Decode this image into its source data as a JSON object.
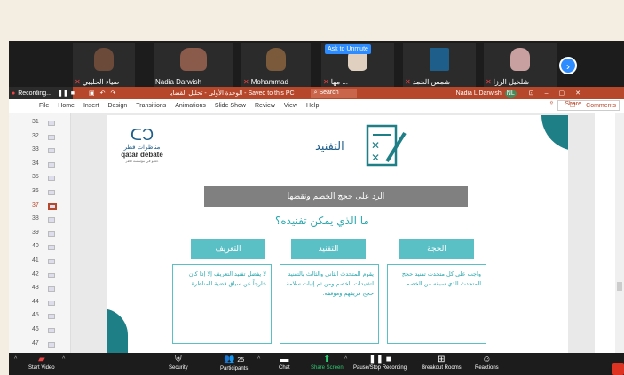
{
  "participants": [
    {
      "name": "ضياء الحليبي",
      "color": "#6b4a3a"
    },
    {
      "name": "Nadia Darwish",
      "color": "#8a5a4a"
    },
    {
      "name": "Mohammad",
      "color": "#7a5a3a"
    },
    {
      "name": "مها ...",
      "color": "#e0d0c0",
      "ask_to_unmute": "Ask to Unmute"
    },
    {
      "name": "شمس الحمد",
      "color": "#1e5e8a"
    },
    {
      "name": "شلخيل الرزا",
      "color": "#c8a0a0"
    }
  ],
  "recording": {
    "label": "Recording..."
  },
  "ppt": {
    "window_title": "الوحدة الأولى - تحليل القضايا - Saved to this PC",
    "search_placeholder": "Search",
    "user_name": "Nadia L Darwish",
    "user_initials": "NL",
    "menu": [
      "File",
      "Home",
      "Insert",
      "Design",
      "Transitions",
      "Animations",
      "Slide Show",
      "Review",
      "View",
      "Help"
    ],
    "share_label": "Share",
    "comments_label": "Comments",
    "slide_numbers": [
      "31",
      "32",
      "33",
      "34",
      "35",
      "36",
      "37",
      "38",
      "39",
      "40",
      "41",
      "42",
      "43",
      "44",
      "45",
      "46",
      "47"
    ],
    "selected_slide": "37"
  },
  "slide": {
    "logo_ar": "مناظرات قطر",
    "logo_en": "qatar debate",
    "logo_sub": "عضو في مؤسسة قطر",
    "title": "التفنيد",
    "subtitle": "الرد على حجج الخصم ونقضها",
    "question": "ما الذي يمكن تفنيده؟",
    "boxes": [
      {
        "label": "الحجة",
        "text": "واجب على كل متحدث تفنيد حجج المتحدث الذي سبقه من الخصم."
      },
      {
        "label": "التفنيد",
        "text": "يقوم المتحدث الثاني والثالث بالتفنيد لتفنيدات الخصم ومن ثم إثبات سلامة حجج فريقهم وموقفه."
      },
      {
        "label": "التعريف",
        "text": "لا يفضل تفنيد التعريف إلا إذا كان خارجاً عن سياق قضية المناظرة."
      }
    ],
    "accent": "#5bc0c6"
  },
  "toolbar": [
    {
      "label": "Start Video",
      "icon": "video-off-icon"
    },
    {
      "label": "Security",
      "icon": "shield-icon"
    },
    {
      "label": "Participants",
      "icon": "participants-icon",
      "count": "25"
    },
    {
      "label": "Chat",
      "icon": "chat-icon"
    },
    {
      "label": "Share Screen",
      "icon": "share-screen-icon"
    },
    {
      "label": "Pause/Stop Recording",
      "icon": "pause-icon"
    },
    {
      "label": "Breakout Rooms",
      "icon": "breakout-icon"
    },
    {
      "label": "Reactions",
      "icon": "reactions-icon"
    }
  ]
}
